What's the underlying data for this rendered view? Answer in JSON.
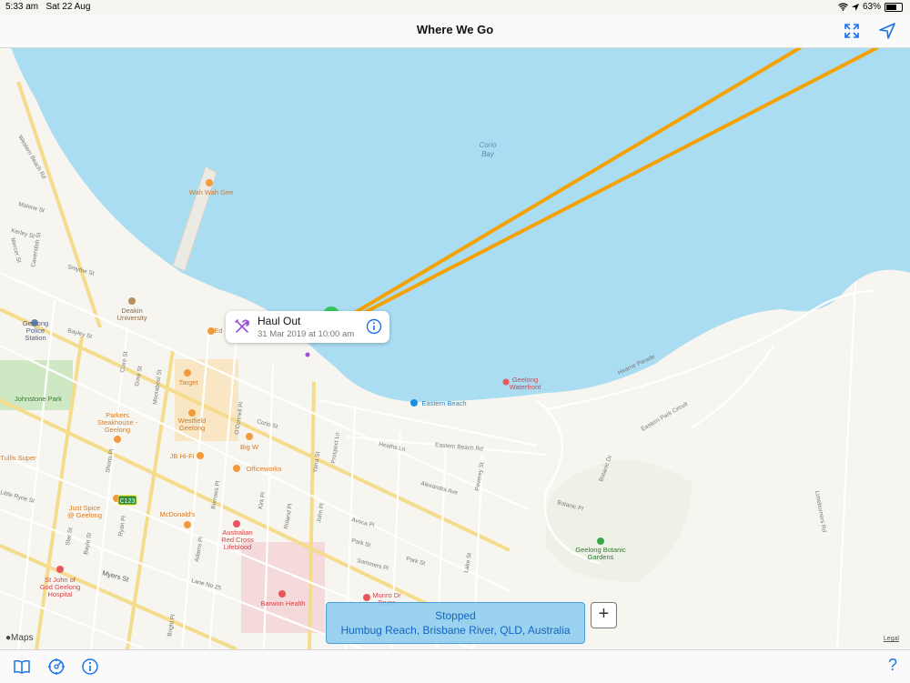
{
  "status_bar": {
    "time": "5:33 am",
    "date": "Sat 22 Aug",
    "battery": "63%"
  },
  "navbar": {
    "title": "Where We Go"
  },
  "map": {
    "water_label": "Corio\nBay",
    "labels": {
      "wah_wah_gee": "Wah Wah Gee",
      "deakin": "Deakin\nUniversity",
      "police": "Geelong\nPolice\nStation",
      "johnstone": "Johnstone Park",
      "target": "Target",
      "westfield": "Westfield\nGeelong",
      "parkers": "Parkers\nSteakhouse -\nGeelong",
      "big_w": "Big W",
      "jb_hifi": "JB Hi-Fi",
      "officeworks": "Officeworks",
      "just_spice": "Just Spice\n@ Geelong",
      "mcdonalds": "McDonald's",
      "red_cross": "Australian\nRed Cross\nLifeblood",
      "st_john": "St John of\nGod Geelong\nHospital",
      "barwon": "Barwon Health",
      "munro": "Munro Dr\nBruce",
      "waterfront": "Geelong\nWaterfront",
      "eastern_beach": "Eastern Beach",
      "botanic": "Geelong Botanic\nGardens",
      "tullis": "Tullis Super",
      "ed": "Ed",
      "route_c123": "C123"
    },
    "streets": {
      "western_beach": "Western Beach Rd",
      "malone": "Malone St",
      "kerley": "Kerley St",
      "mercer": "Mercer St",
      "cavendish": "Cavendish St",
      "smythe": "Smythe St",
      "bayley": "Bayley St",
      "clare": "Clare St",
      "gore": "Gore St",
      "moorabool": "Moorabool St",
      "oconnell": "O'Connell Pl",
      "corio": "Corio St",
      "yarra": "Yarra St",
      "prospect": "Prospect Ln",
      "heaths": "Heaths Ln",
      "eastern_beach_rd": "Eastern Beach Rd",
      "alexandra": "Alexandra Ave",
      "peverey": "Peverey St",
      "hearne": "Hearne Parade",
      "eastern_park": "Eastern Park Circuit",
      "botanic_dr": "Botanic Dr",
      "botanic_pl": "Botanic Pl",
      "limeburners": "Limeburners Rd",
      "avoca": "Avoca Pl",
      "park": "Park St",
      "sommers": "Sommers Pl",
      "lake": "Lake St",
      "myers": "Myers St",
      "little_ryrie": "Little Ryrie St",
      "lane_no25": "Lane No 25",
      "shorts": "Shorts Pl",
      "ryan": "Ryan Pl",
      "star": "Star St",
      "bayle": "Bayle St",
      "burrows": "Burrows Pl",
      "kirk": "Kirk Pl",
      "roland": "Roland Pl",
      "john": "John Pl",
      "adams": "Adams Pl",
      "bright": "Bright Pl"
    }
  },
  "callout": {
    "title": "Haul Out",
    "subtitle": "31 Mar 2019 at 10:00 am",
    "icon": "tools-icon"
  },
  "status": {
    "line1": "Stopped",
    "line2": "Humbug Reach, Brisbane River, QLD, Australia"
  },
  "add_label": "+",
  "maps_logo": "Maps",
  "legal": "Legal",
  "toolbar": {
    "help": "?"
  },
  "colors": {
    "water": "#aadcf2",
    "land": "#f7f5ef",
    "route": "#f5a200",
    "accent": "#1a73e8"
  }
}
